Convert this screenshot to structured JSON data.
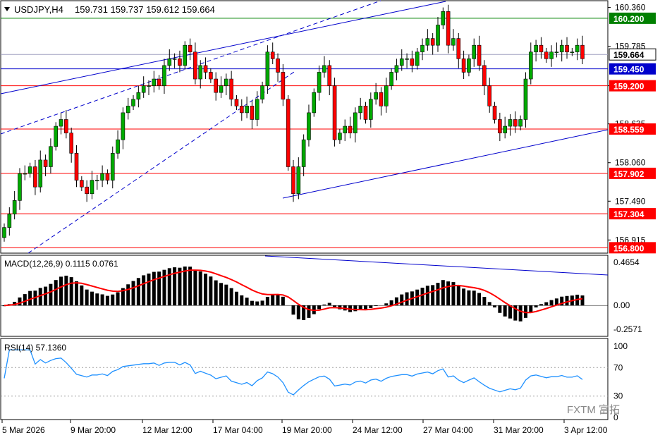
{
  "header": {
    "symbol": "USDJPY,H4",
    "ohlc": "159.731 159.737 159.612 159.664"
  },
  "macd": {
    "label": "MACD(12,26,9) 0.1115 0.0761",
    "ticks": [
      "0.4654",
      "0.00",
      "-0.2571"
    ]
  },
  "rsi": {
    "label": "RSI(14) 57.1360",
    "ticks": [
      "100",
      "70",
      "30",
      "0"
    ]
  },
  "price_axis": {
    "ticks": [
      "160.360",
      "159.785",
      "159.200",
      "158.635",
      "158.060",
      "157.490",
      "156.915"
    ],
    "current_price": "159.664",
    "level_tags": [
      {
        "value": "160.200",
        "color": "#008000"
      },
      {
        "value": "159.450",
        "color": "#0000cc"
      },
      {
        "value": "159.200",
        "color": "#ff0000"
      },
      {
        "value": "158.559",
        "color": "#ff0000"
      },
      {
        "value": "157.902",
        "color": "#ff0000"
      },
      {
        "value": "157.304",
        "color": "#ff0000"
      },
      {
        "value": "156.800",
        "color": "#ff0000"
      }
    ]
  },
  "time_axis": [
    "5 Mar 2026",
    "9 Mar 20:00",
    "12 Mar 12:00",
    "17 Mar 04:00",
    "19 Mar 20:00",
    "24 Mar 12:00",
    "27 Mar 04:00",
    "31 Mar 20:00",
    "3 Apr 12:00"
  ],
  "watermark": "FXTM 富拓",
  "colors": {
    "bull": "#00aa00",
    "bear": "#ff0000",
    "grid_line": "#c0c0c0",
    "trend": "#0000cc"
  },
  "chart_data": {
    "type": "candlestick",
    "closes": [
      157.1,
      157.3,
      157.5,
      157.9,
      157.9,
      158.0,
      157.7,
      158.1,
      158.0,
      158.3,
      158.6,
      158.7,
      158.5,
      158.2,
      157.8,
      157.7,
      157.6,
      157.8,
      157.8,
      157.9,
      157.8,
      158.2,
      158.4,
      158.8,
      158.9,
      159.0,
      159.1,
      159.2,
      159.2,
      159.3,
      159.2,
      159.5,
      159.6,
      159.6,
      159.5,
      159.8,
      159.7,
      159.3,
      159.5,
      159.4,
      159.3,
      159.1,
      159.2,
      159.3,
      159.0,
      158.9,
      158.8,
      158.9,
      158.7,
      159.0,
      159.2,
      159.7,
      159.6,
      159.4,
      159.0,
      158.0,
      157.6,
      158.0,
      158.4,
      158.8,
      159.1,
      159.4,
      159.5,
      159.2,
      158.4,
      158.5,
      158.6,
      158.5,
      158.8,
      158.9,
      158.7,
      159.0,
      159.1,
      158.9,
      159.2,
      159.4,
      159.5,
      159.6,
      159.6,
      159.5,
      159.7,
      159.8,
      159.9,
      159.8,
      160.1,
      160.3,
      159.8,
      159.9,
      159.6,
      159.4,
      159.6,
      159.8,
      159.5,
      159.2,
      158.9,
      158.7,
      158.5,
      158.6,
      158.7,
      158.6,
      158.7,
      159.3,
      159.7,
      159.8,
      159.7,
      159.6,
      159.7,
      159.7,
      159.8,
      159.7,
      159.7,
      159.8,
      159.6
    ]
  }
}
